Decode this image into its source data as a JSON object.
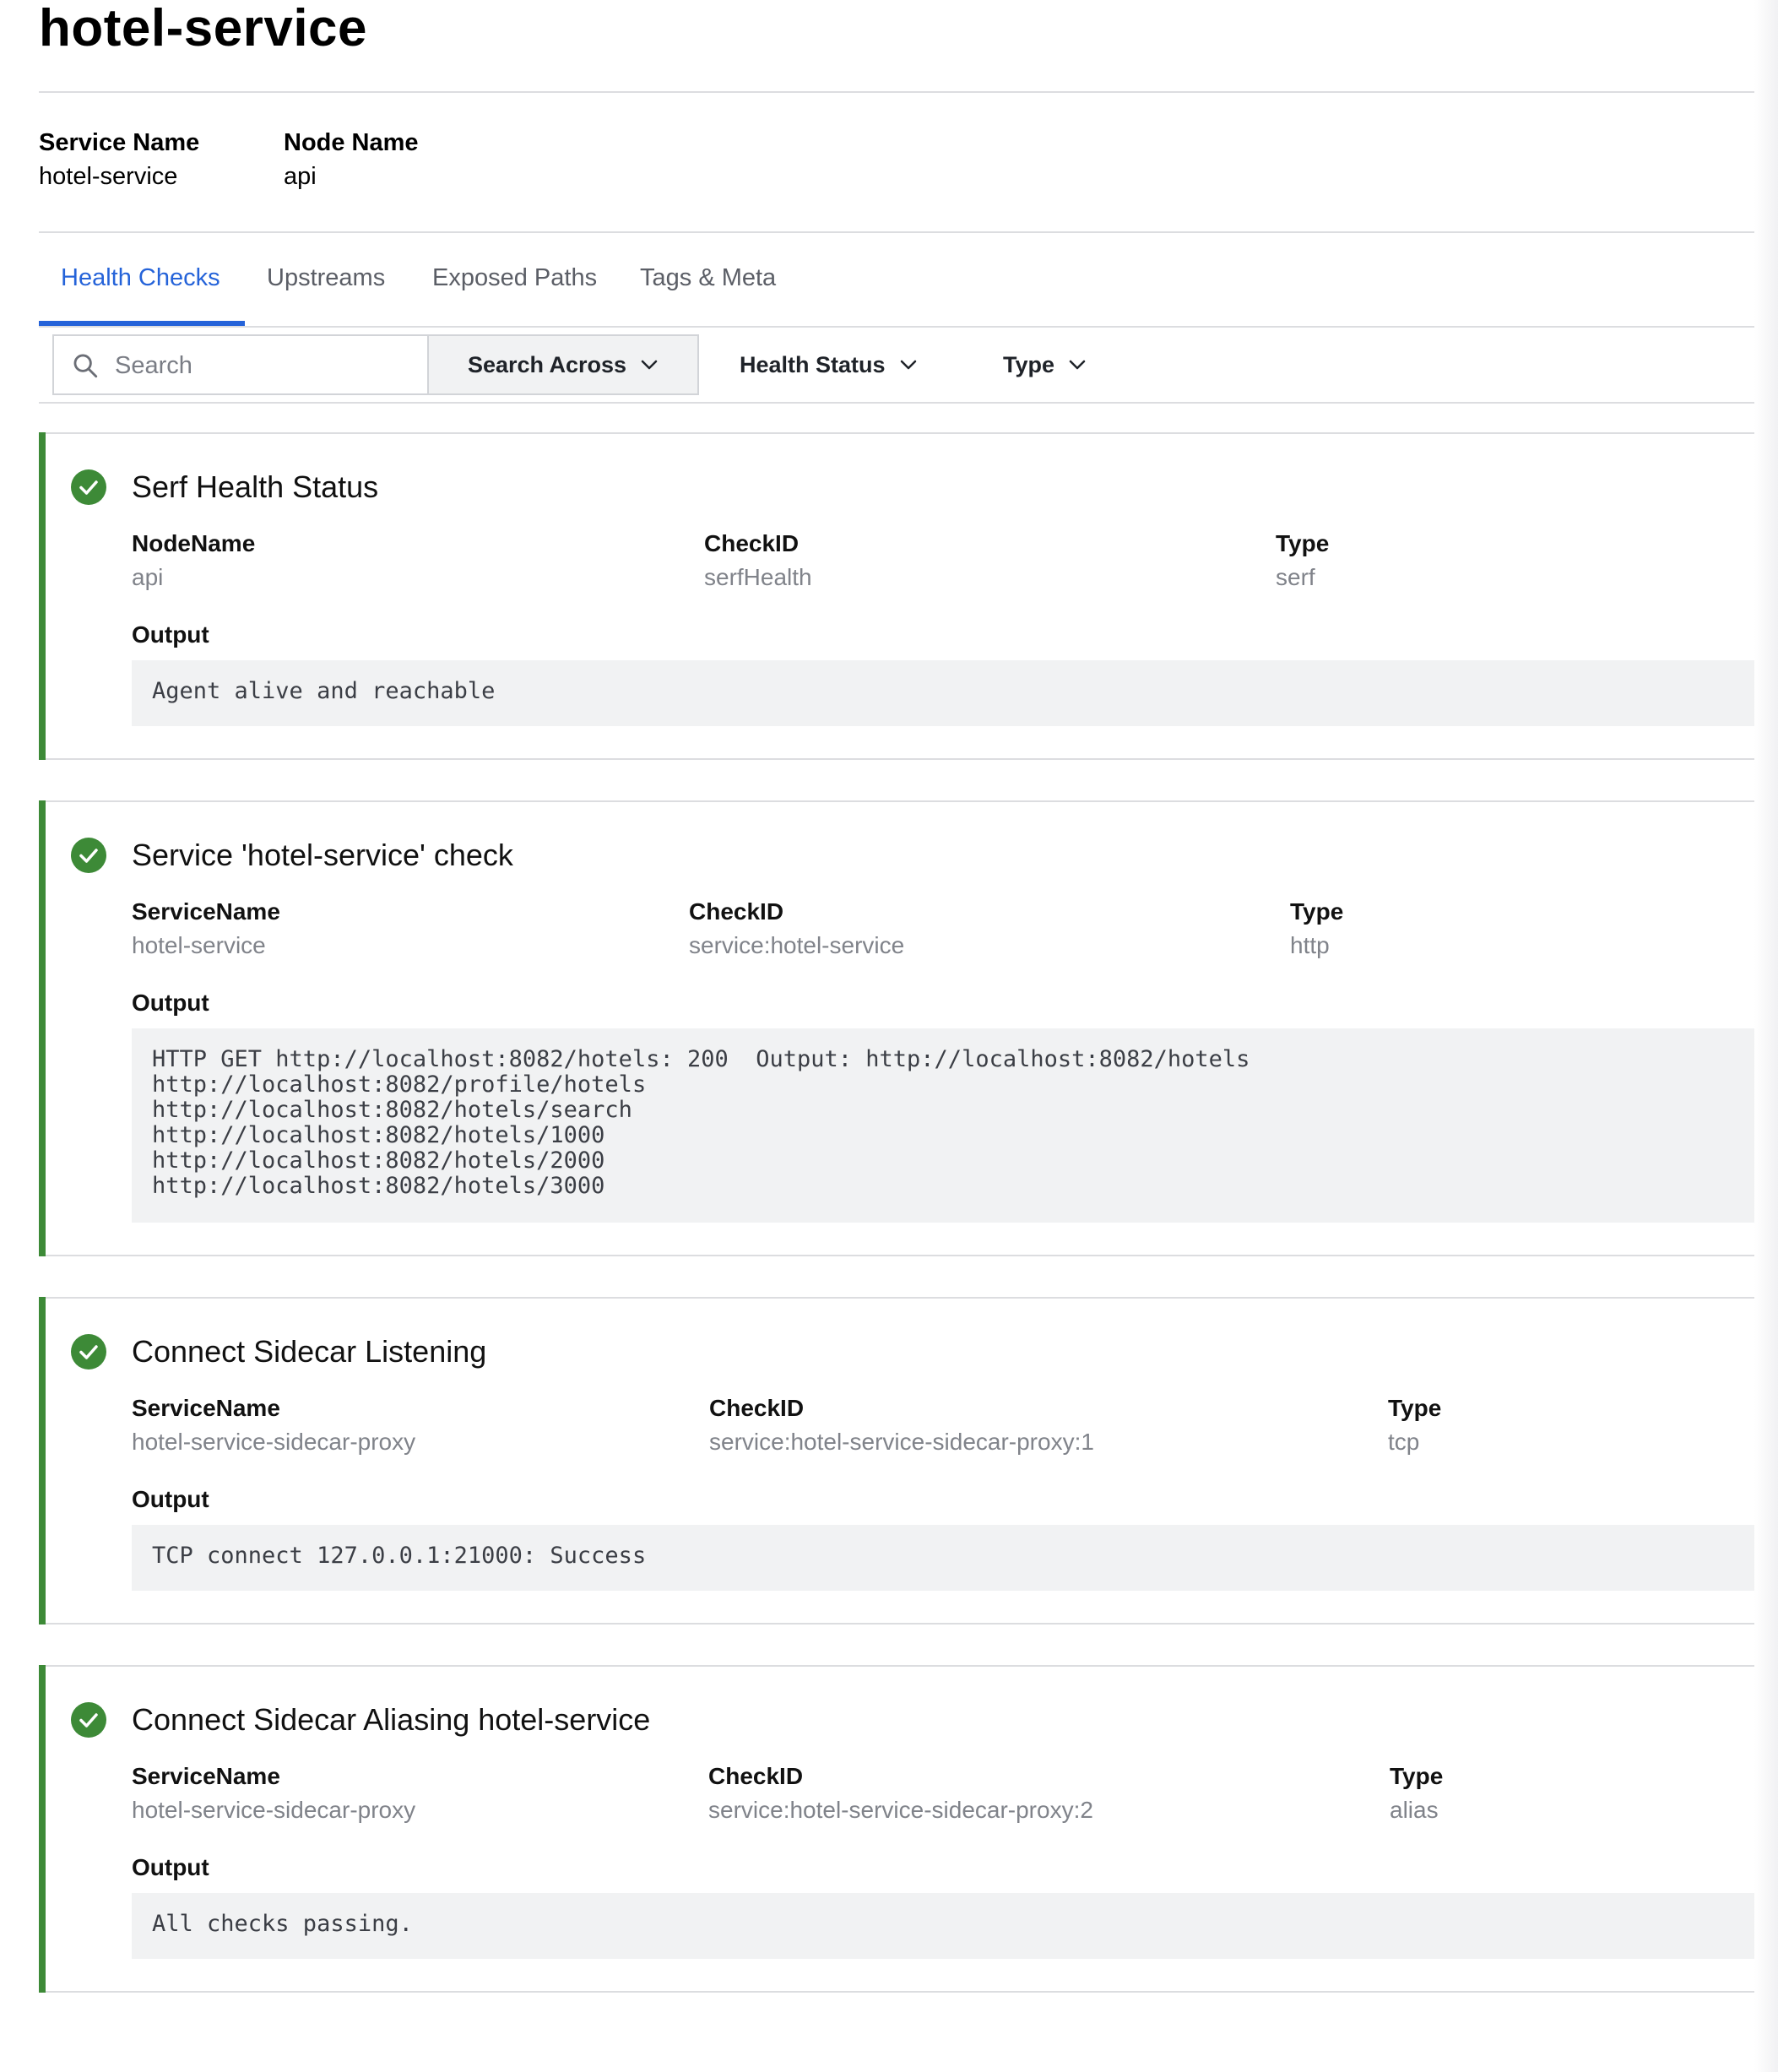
{
  "header": {
    "title": "hotel-service"
  },
  "info": {
    "service_name_label": "Service Name",
    "service_name_value": "hotel-service",
    "node_name_label": "Node Name",
    "node_name_value": "api"
  },
  "tabs": [
    {
      "label": "Health Checks",
      "active": true
    },
    {
      "label": "Upstreams",
      "active": false
    },
    {
      "label": "Exposed Paths",
      "active": false
    },
    {
      "label": "Tags & Meta",
      "active": false
    }
  ],
  "filters": {
    "search_placeholder": "Search",
    "search_across": "Search Across",
    "health_status": "Health Status",
    "type": "Type"
  },
  "colors": {
    "accent": "#2563d9",
    "passing": "#3d8a37"
  },
  "checks": [
    {
      "status_icon": "check-circle-icon",
      "title": "Serf Health Status",
      "fields": [
        {
          "label": "NodeName",
          "value": "api"
        },
        {
          "label": "CheckID",
          "value": "serfHealth"
        },
        {
          "label": "Type",
          "value": "serf"
        }
      ],
      "output_label": "Output",
      "output": "Agent alive and reachable"
    },
    {
      "status_icon": "check-circle-icon",
      "title": "Service 'hotel-service' check",
      "fields": [
        {
          "label": "ServiceName",
          "value": "hotel-service"
        },
        {
          "label": "CheckID",
          "value": "service:hotel-service"
        },
        {
          "label": "Type",
          "value": "http"
        }
      ],
      "output_label": "Output",
      "output": "HTTP GET http://localhost:8082/hotels: 200  Output: http://localhost:8082/hotels\nhttp://localhost:8082/profile/hotels\nhttp://localhost:8082/hotels/search\nhttp://localhost:8082/hotels/1000\nhttp://localhost:8082/hotels/2000\nhttp://localhost:8082/hotels/3000"
    },
    {
      "status_icon": "check-circle-icon",
      "title": "Connect Sidecar Listening",
      "fields": [
        {
          "label": "ServiceName",
          "value": "hotel-service-sidecar-proxy"
        },
        {
          "label": "CheckID",
          "value": "service:hotel-service-sidecar-proxy:1"
        },
        {
          "label": "Type",
          "value": "tcp"
        }
      ],
      "output_label": "Output",
      "output": "TCP connect 127.0.0.1:21000: Success"
    },
    {
      "status_icon": "check-circle-icon",
      "title": "Connect Sidecar Aliasing hotel-service",
      "fields": [
        {
          "label": "ServiceName",
          "value": "hotel-service-sidecar-proxy"
        },
        {
          "label": "CheckID",
          "value": "service:hotel-service-sidecar-proxy:2"
        },
        {
          "label": "Type",
          "value": "alias"
        }
      ],
      "output_label": "Output",
      "output": "All checks passing."
    }
  ]
}
